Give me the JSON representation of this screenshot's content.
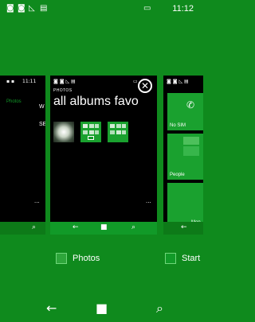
{
  "status_bar": {
    "time": "11:12",
    "icons": [
      "signal-icon-1",
      "signal-icon-2",
      "wifi-icon",
      "message-icon",
      "battery-icon"
    ]
  },
  "left_card": {
    "label_w": "W",
    "label_se": "SE",
    "small_label": "Photos",
    "more": "...",
    "time": "11:11"
  },
  "center_card": {
    "section": "PHOTOS",
    "title": "all albums favo",
    "more": "..."
  },
  "right_card": {
    "tile_no_sim": "No SIM",
    "tile_people": "People",
    "tile_more": "Mon"
  },
  "app_labels": {
    "photos": "Photos",
    "start": "Start"
  },
  "colors": {
    "background": "#0f8a1d",
    "accent": "#119a28",
    "tile": "#1aa12f",
    "card": "#000000"
  }
}
